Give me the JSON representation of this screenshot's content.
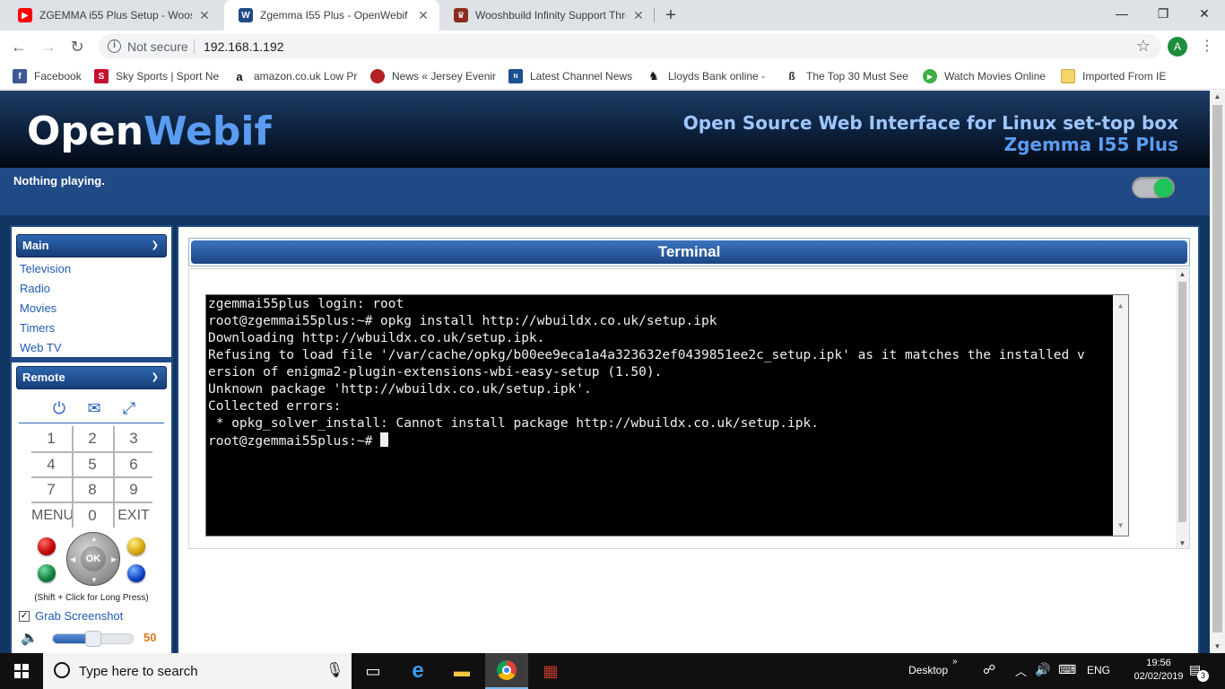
{
  "browser": {
    "tabs": [
      {
        "title": "ZGEMMA i55 Plus Setup - Woosh",
        "icon": "youtube-icon",
        "color": "#ff0000"
      },
      {
        "title": "Zgemma I55 Plus - OpenWebif",
        "icon": "openwebif-icon",
        "color": "#1f4a85"
      },
      {
        "title": "Wooshbuild Infinity Support Thre",
        "icon": "wooshbuild-icon",
        "color": "#8b2c1f"
      }
    ],
    "not_secure": "Not secure",
    "url": "192.168.1.192",
    "profile_initial": "A",
    "bookmarks": [
      {
        "label": "Facebook",
        "icon": "facebook-icon",
        "color": "#3b5998"
      },
      {
        "label": "Sky Sports | Sport Ne",
        "icon": "sky-sports-icon",
        "color": "#c8102e"
      },
      {
        "label": "amazon.co.uk Low Pr",
        "icon": "amazon-icon",
        "color": "#ff9900"
      },
      {
        "label": "News « Jersey Evenin",
        "icon": "news-icon",
        "color": "#b22222"
      },
      {
        "label": "Latest Channel News",
        "icon": "channel-news-icon",
        "color": "#1d4f91"
      },
      {
        "label": "Lloyds Bank online -",
        "icon": "lloyds-icon",
        "color": "#006a4d"
      },
      {
        "label": "The Top 30 Must See",
        "icon": "top30-icon",
        "color": "#333333"
      },
      {
        "label": "Watch Movies Online",
        "icon": "play-icon",
        "color": "#3cb043"
      },
      {
        "label": "Imported From IE",
        "icon": "folder-icon",
        "color": "#f4c542"
      }
    ]
  },
  "page": {
    "logo_open": "Open",
    "logo_webif": "Webif",
    "tagline": "Open Source Web Interface for Linux set-top box",
    "model": "Zgemma I55 Plus",
    "now_playing": "Nothing playing.",
    "colors": {
      "accent": "#5a9cf1",
      "panel_border": "#1f4a85",
      "link": "#1f5ab2"
    }
  },
  "sidebar": {
    "main_header": "Main",
    "main_items": [
      "Television",
      "Radio",
      "Movies",
      "Timers",
      "Web TV"
    ],
    "remote_header": "Remote",
    "keys": [
      "1",
      "2",
      "3",
      "4",
      "5",
      "6",
      "7",
      "8",
      "9",
      "MENU",
      "0",
      "EXIT"
    ],
    "ok_label": "OK",
    "long_press": "(Shift + Click for Long Press)",
    "grab_screenshot": "Grab Screenshot",
    "grab_checked": "✓",
    "volume": 50,
    "volume_label": "50"
  },
  "terminal": {
    "title": "Terminal",
    "lines": [
      "zgemmai55plus login: root",
      "root@zgemmai55plus:~# opkg install http://wbuildx.co.uk/setup.ipk",
      "Downloading http://wbuildx.co.uk/setup.ipk.",
      "Refusing to load file '/var/cache/opkg/b00ee9eca1a4a323632ef0439851ee2c_setup.ipk' as it matches the installed v",
      "ersion of enigma2-plugin-extensions-wbi-easy-setup (1.50).",
      "Unknown package 'http://wbuildx.co.uk/setup.ipk'.",
      "Collected errors:",
      " * opkg_solver_install: Cannot install package http://wbuildx.co.uk/setup.ipk."
    ],
    "prompt": "root@zgemmai55plus:~# "
  },
  "taskbar": {
    "search_placeholder": "Type here to search",
    "desktop_label": "Desktop",
    "language": "ENG",
    "time": "19:56",
    "date": "02/02/2019",
    "notifications": "3"
  }
}
